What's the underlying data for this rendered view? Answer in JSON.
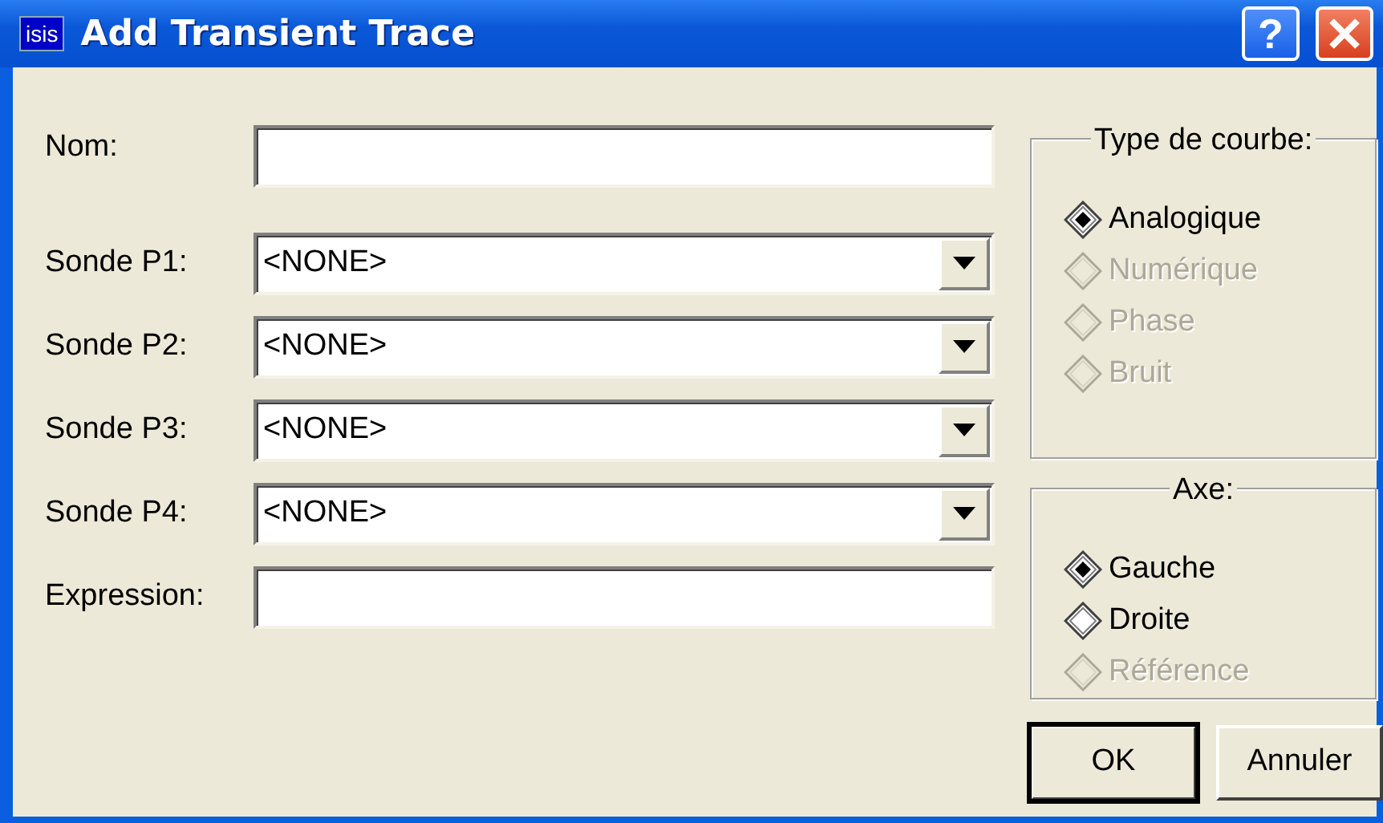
{
  "window": {
    "icon_text": "isis",
    "title": "Add Transient Trace",
    "help_button": "?"
  },
  "fields": [
    {
      "kind": "text",
      "label": "Nom:"
    },
    {
      "kind": "combo",
      "label": "Sonde P1:",
      "value": "<NONE>"
    },
    {
      "kind": "combo",
      "label": "Sonde P2:",
      "value": "<NONE>"
    },
    {
      "kind": "combo",
      "label": "Sonde P3:",
      "value": "<NONE>"
    },
    {
      "kind": "combo",
      "label": "Sonde P4:",
      "value": "<NONE>"
    },
    {
      "kind": "text",
      "label": "Expression:"
    }
  ],
  "groups": [
    {
      "title": "Type de courbe:",
      "options": [
        {
          "label": "Analogique",
          "selected": true,
          "disabled": false
        },
        {
          "label": "Numérique",
          "selected": false,
          "disabled": true
        },
        {
          "label": "Phase",
          "selected": false,
          "disabled": true
        },
        {
          "label": "Bruit",
          "selected": false,
          "disabled": true
        }
      ]
    },
    {
      "title": "Axe:",
      "options": [
        {
          "label": "Gauche",
          "selected": true,
          "disabled": false
        },
        {
          "label": "Droite",
          "selected": false,
          "disabled": false
        },
        {
          "label": "Référence",
          "selected": false,
          "disabled": true
        }
      ]
    }
  ],
  "buttons": [
    {
      "label": "OK",
      "default": true
    },
    {
      "label": "Annuler",
      "default": false
    }
  ]
}
